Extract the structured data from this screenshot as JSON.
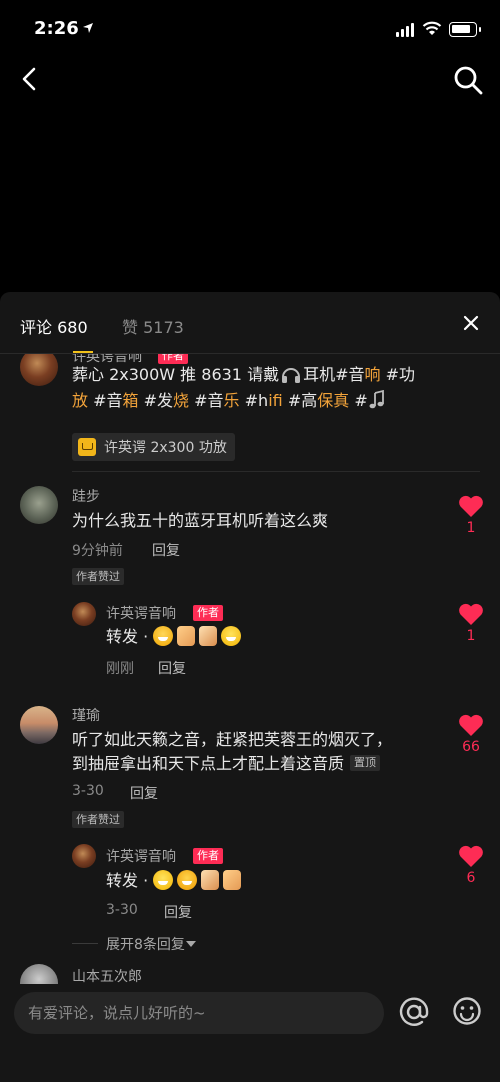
{
  "status": {
    "time": "2:26"
  },
  "tabs": {
    "comments": "评论 680",
    "likes": "赞 5173"
  },
  "comments": [
    {
      "name": "许英谔音响",
      "author_tag": "作者",
      "line1_a": "葬心 2x300W 推 8631 请戴",
      "line1_b": "耳机#音",
      "line1_c": "响",
      "line1_d": " #功",
      "line2": [
        {
          "t": "放",
          "hl": true
        },
        {
          "t": " #音",
          "hl": false
        },
        {
          "t": "箱",
          "hl": true
        },
        {
          "t": " #发",
          "hl": false
        },
        {
          "t": "烧",
          "hl": true
        },
        {
          "t": " #音",
          "hl": false
        },
        {
          "t": "乐",
          "hl": true
        },
        {
          "t": " #h",
          "hl": false
        },
        {
          "t": "ifi",
          "hl": true
        },
        {
          "t": " #高",
          "hl": false
        },
        {
          "t": "保真",
          "hl": true
        },
        {
          "t": " #",
          "hl": false
        }
      ],
      "product": "许英谔 2x300 功放"
    },
    {
      "name": "跬步",
      "text": "为什么我五十的蓝牙耳机听着这么爽",
      "time": "9分钟前",
      "reply": "回复",
      "badge": "作者赞过",
      "likes": "1",
      "sub": {
        "name": "许英谔音响",
        "author_tag": "作者",
        "text": "转发 · ",
        "time": "刚刚",
        "reply": "回复",
        "likes": "1"
      }
    },
    {
      "name": "瑾瑜",
      "line1": "听了如此天籁之音，赶紧把芙蓉王的烟灭了，",
      "line2": "到抽屉拿出和天下点上才配上着这音质",
      "pin": "置顶",
      "time": "3-30",
      "reply": "回复",
      "badge": "作者赞过",
      "likes": "66",
      "sub": {
        "name": "许英谔音响",
        "author_tag": "作者",
        "text": "转发 · ",
        "time": "3-30",
        "reply": "回复",
        "likes": "6"
      },
      "expand": "展开8条回复"
    },
    {
      "name": "山本五次郎"
    }
  ],
  "input": {
    "placeholder": "有爱评论，说点儿好听的~"
  },
  "colors": {
    "accent_red": "#fe2c55",
    "highlight": "#f2a33a",
    "tab_underline": "#f2c21a"
  },
  "icons": [
    "back-arrow-icon",
    "search-icon",
    "close-icon",
    "heart-icon",
    "at-icon",
    "emoji-icon",
    "cart-icon",
    "headphones-icon",
    "music-note-icon"
  ]
}
